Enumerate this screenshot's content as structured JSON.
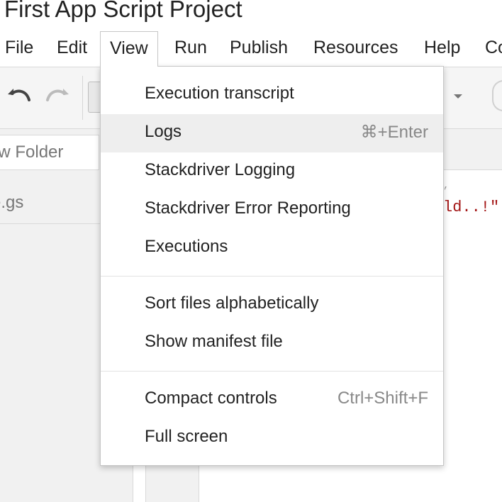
{
  "window": {
    "title": "First App Script Project"
  },
  "menubar": {
    "items": [
      {
        "label": "File"
      },
      {
        "label": "Edit"
      },
      {
        "label": "View"
      },
      {
        "label": "Run"
      },
      {
        "label": "Publish"
      },
      {
        "label": "Resources"
      },
      {
        "label": "Help"
      },
      {
        "label": "Co"
      }
    ],
    "active": "View"
  },
  "toolbar": {
    "undo_icon": "undo-icon",
    "redo_icon": "redo-icon"
  },
  "sidebar": {
    "new_folder_label": "ew Folder",
    "file_label": "e.gs"
  },
  "editor": {
    "code_fragment": "ld..!\"",
    "code_fragment_top": ","
  },
  "view_menu": {
    "groups": [
      [
        {
          "label": "Execution transcript",
          "shortcut": ""
        },
        {
          "label": "Logs",
          "shortcut": "⌘+Enter",
          "highlighted": true
        },
        {
          "label": "Stackdriver Logging",
          "shortcut": ""
        },
        {
          "label": "Stackdriver Error Reporting",
          "shortcut": ""
        },
        {
          "label": "Executions",
          "shortcut": ""
        }
      ],
      [
        {
          "label": "Sort files alphabetically",
          "shortcut": ""
        },
        {
          "label": "Show manifest file",
          "shortcut": ""
        }
      ],
      [
        {
          "label": "Compact controls",
          "shortcut": "Ctrl+Shift+F"
        },
        {
          "label": "Full screen",
          "shortcut": ""
        }
      ]
    ]
  },
  "colors": {
    "menu_hover": "#eeeeee",
    "string_literal": "#a31515",
    "panel_bg": "#f1f1f1"
  }
}
